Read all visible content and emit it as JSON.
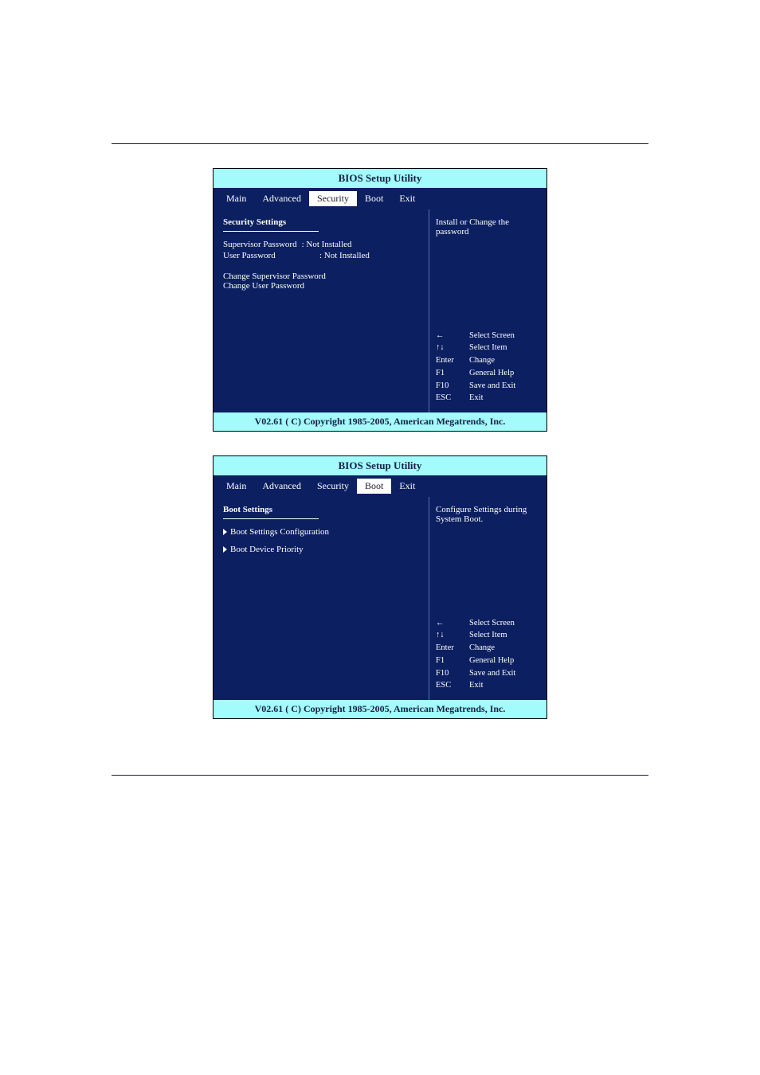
{
  "title": "BIOS Setup Utility",
  "tabs": [
    "Main",
    "Advanced",
    "Security",
    "Boot",
    "Exit"
  ],
  "footer": "V02.61  ( C) Copyright 1985-2005, American Megatrends, Inc.",
  "security": {
    "heading": "Security Settings",
    "rows": [
      {
        "label": "Supervisor Password",
        "value": ": Not Installed"
      },
      {
        "label": "User Password",
        "value": ": Not Installed"
      }
    ],
    "items": [
      "Change Supervisor Password",
      "Change User Password"
    ],
    "help": "Install or Change the password"
  },
  "boot": {
    "heading": "Boot Settings",
    "items": [
      "Boot Settings Configuration",
      "Boot Device Priority"
    ],
    "help": "Configure Settings during System Boot."
  },
  "keys": [
    {
      "k": "←",
      "d": "Select Screen"
    },
    {
      "k": "↑↓",
      "d": "Select Item"
    },
    {
      "k": "Enter",
      "d": "Change"
    },
    {
      "k": "F1",
      "d": "General Help"
    },
    {
      "k": "F10",
      "d": "Save and Exit"
    },
    {
      "k": "ESC",
      "d": "Exit"
    }
  ]
}
